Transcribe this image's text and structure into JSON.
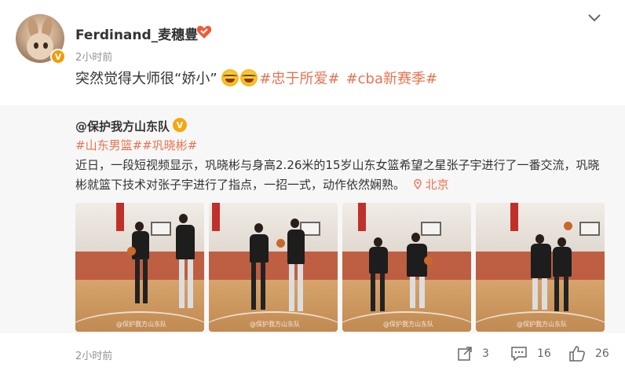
{
  "post": {
    "author": "Ferdinand_麦穗豊",
    "time": "2小时前",
    "text_main": "突然觉得大师很“娇小”",
    "hashtags": [
      "#忠于所爱#",
      "#cba新赛季#"
    ],
    "emoji_count": 2
  },
  "repost": {
    "author": "@保护我方山东队",
    "tags": "#山东男篮##巩晓彬#",
    "text": "近日，一段短视频显示，巩晓彬与身高2.26米的15岁山东女篮希望之星张子宇进行了一番交流，巩晓彬就篮下技术对张子宇进行了指点，一招一式，动作依然娴熟。",
    "location": "北京"
  },
  "footer": {
    "time": "2小时前",
    "repost_count": "3",
    "comment_count": "16",
    "like_count": "26"
  },
  "icons": [
    "chevron-down-icon",
    "heart-badge-icon",
    "verified-badge-icon",
    "location-pin-icon",
    "repost-icon",
    "comment-icon",
    "like-icon"
  ],
  "colors": {
    "accent": "#eb7350",
    "badge": "#f49b00",
    "muted": "#939393",
    "repost_bg": "#f7f7f7"
  }
}
